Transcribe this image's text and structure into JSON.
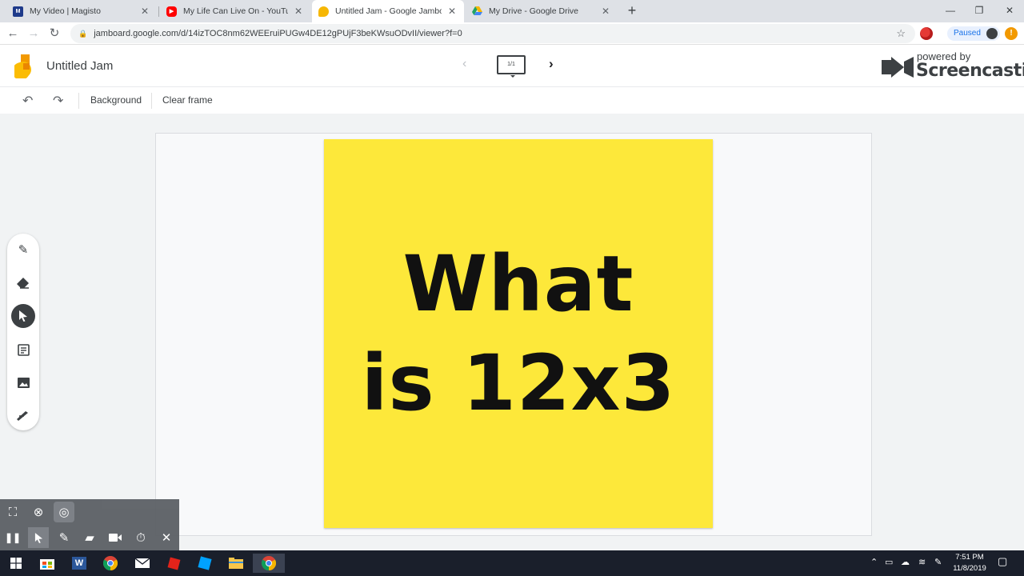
{
  "browser": {
    "tabs": [
      {
        "title": "My Video | Magisto",
        "icon": "magisto-icon",
        "color": "#1e3a8a"
      },
      {
        "title": "My Life Can Live On - YouTube",
        "icon": "youtube-icon",
        "color": "#ff0000"
      },
      {
        "title": "Untitled Jam - Google Jamboard",
        "icon": "jamboard-icon",
        "color": "#f6b704",
        "active": true
      },
      {
        "title": "My Drive - Google Drive",
        "icon": "drive-icon",
        "color": "#1fa463"
      }
    ],
    "url": "jamboard.google.com/d/14izTOC8nm62WEEruiPUGw4DE12gPUjF3beKWsuODvII/viewer?f=0",
    "profile_label": "Paused"
  },
  "jamboard": {
    "title": "Untitled Jam",
    "frame_indicator": "1/1",
    "toolbar": {
      "background_label": "Background",
      "clear_frame_label": "Clear frame"
    },
    "sticky_note": {
      "line1": "What",
      "line2": "is 12x3",
      "color": "#fde83a"
    },
    "tools": [
      "pen-tool",
      "eraser-tool",
      "select-tool",
      "sticky-note-tool",
      "image-tool",
      "laser-tool"
    ],
    "active_tool": "select-tool"
  },
  "screencastify": {
    "brand_small": "powered by",
    "brand_big": "Screencastify"
  },
  "taskbar": {
    "time": "7:51 PM",
    "date": "11/8/2019"
  },
  "colors": {
    "accent_blue": "#1a73e8",
    "jamboard_yellow": "#f6b704"
  }
}
